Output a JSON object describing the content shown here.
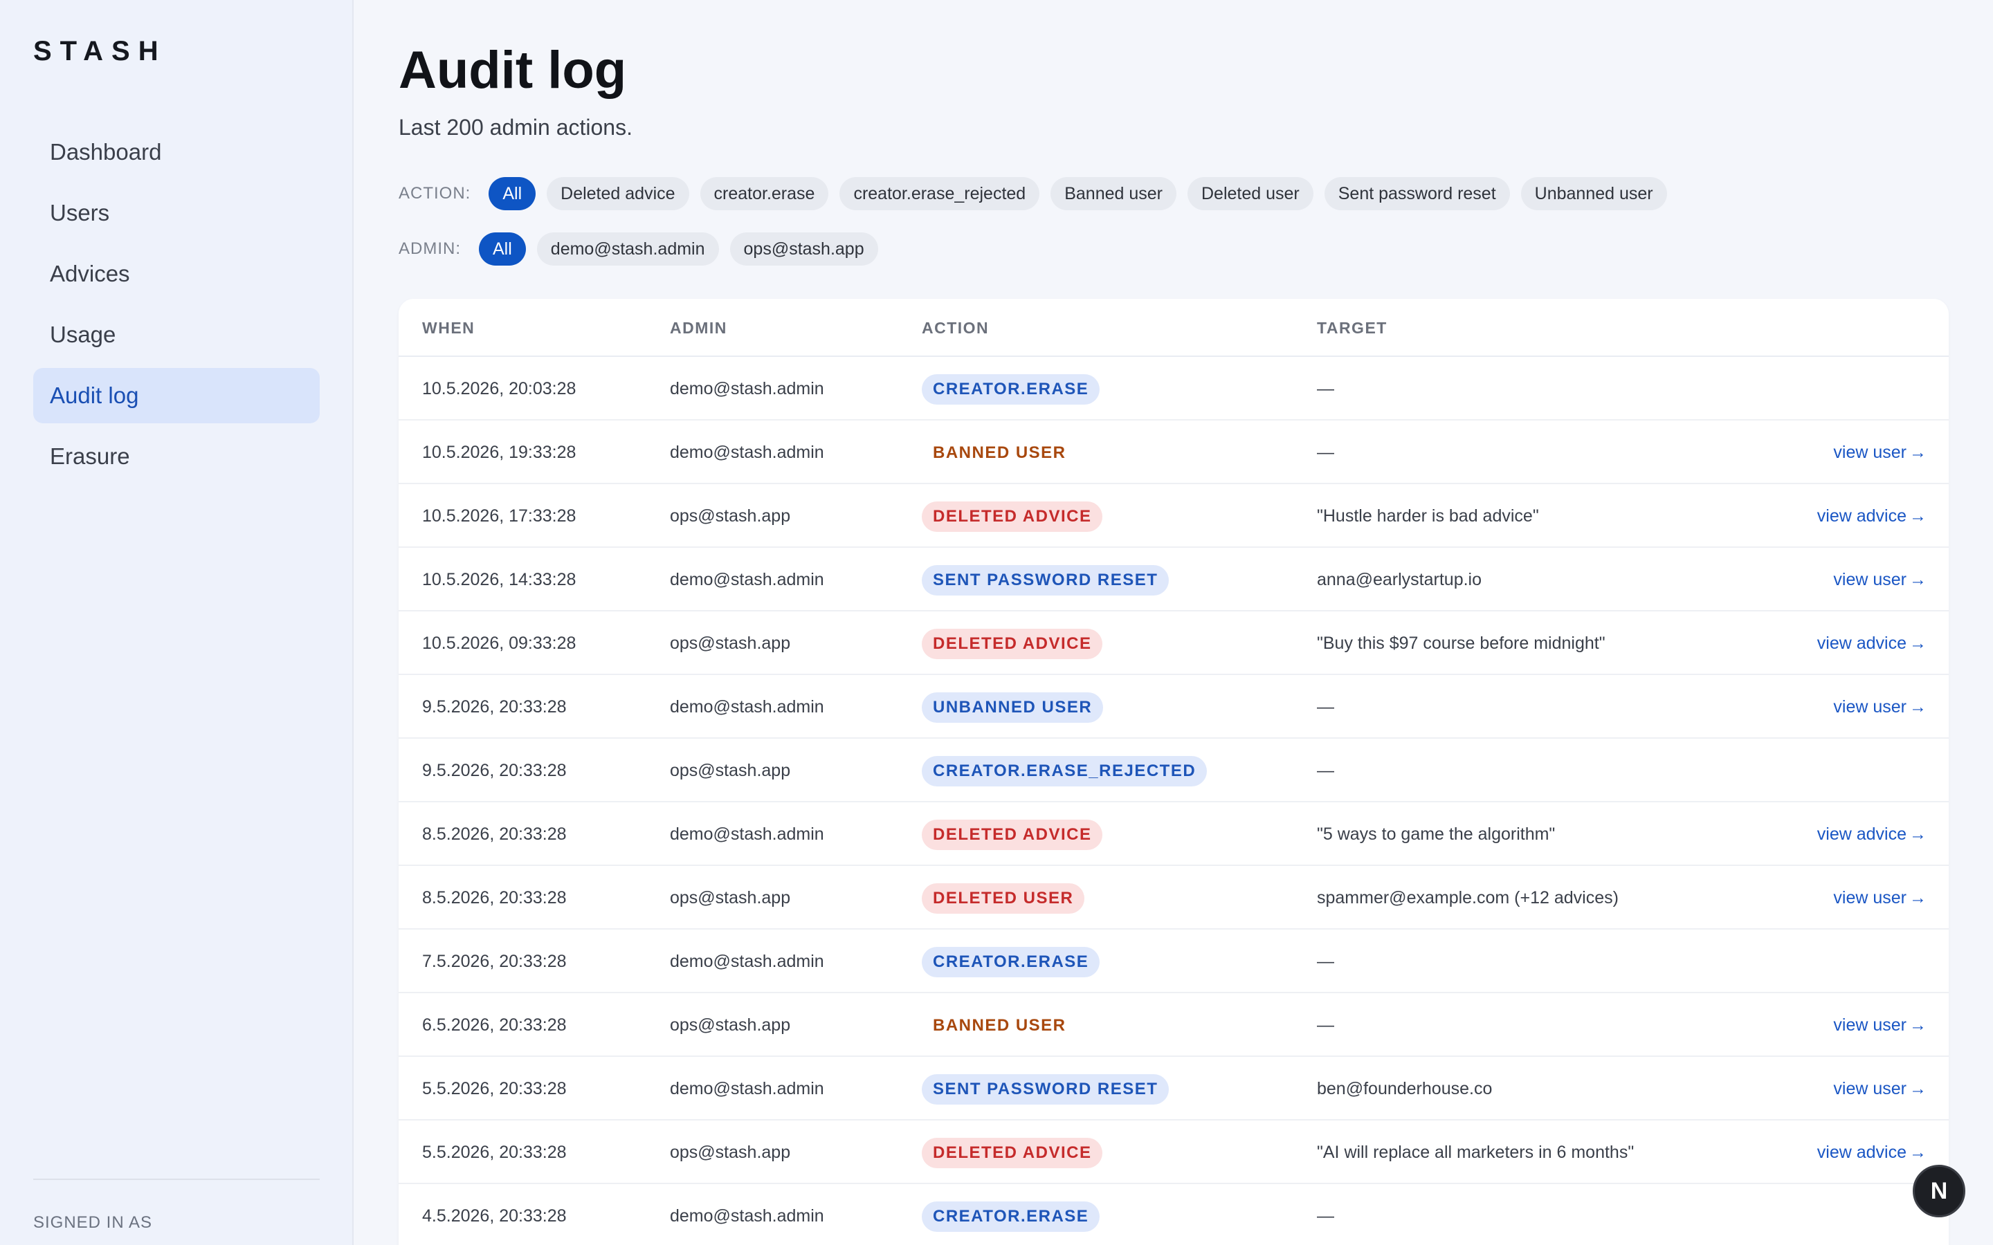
{
  "sidebar": {
    "logo": "STASH",
    "items": [
      {
        "label": "Dashboard",
        "active": false
      },
      {
        "label": "Users",
        "active": false
      },
      {
        "label": "Advices",
        "active": false
      },
      {
        "label": "Usage",
        "active": false
      },
      {
        "label": "Audit log",
        "active": true
      },
      {
        "label": "Erasure",
        "active": false
      }
    ],
    "signed_in_label": "SIGNED IN AS"
  },
  "header": {
    "title": "Audit log",
    "subtitle": "Last 200 admin actions."
  },
  "filters": {
    "action": {
      "label": "ACTION:",
      "chips": [
        "All",
        "Deleted advice",
        "creator.erase",
        "creator.erase_rejected",
        "Banned user",
        "Deleted user",
        "Sent password reset",
        "Unbanned user"
      ],
      "selected": "All"
    },
    "admin": {
      "label": "ADMIN:",
      "chips": [
        "All",
        "demo@stash.admin",
        "ops@stash.app"
      ],
      "selected": "All"
    }
  },
  "table": {
    "columns": [
      "WHEN",
      "ADMIN",
      "ACTION",
      "TARGET"
    ],
    "rows": [
      {
        "when": "10.5.2026, 20:03:28",
        "admin": "demo@stash.admin",
        "action": "CREATOR.ERASE",
        "tone": "blue",
        "target": "—",
        "link": ""
      },
      {
        "when": "10.5.2026, 19:33:28",
        "admin": "demo@stash.admin",
        "action": "BANNED USER",
        "tone": "orange",
        "target": "—",
        "link": "view user"
      },
      {
        "when": "10.5.2026, 17:33:28",
        "admin": "ops@stash.app",
        "action": "DELETED ADVICE",
        "tone": "red",
        "target": "\"Hustle harder is bad advice\"",
        "link": "view advice"
      },
      {
        "when": "10.5.2026, 14:33:28",
        "admin": "demo@stash.admin",
        "action": "SENT PASSWORD RESET",
        "tone": "blue",
        "target": "anna@earlystartup.io",
        "link": "view user"
      },
      {
        "when": "10.5.2026, 09:33:28",
        "admin": "ops@stash.app",
        "action": "DELETED ADVICE",
        "tone": "red",
        "target": "\"Buy this $97 course before midnight\"",
        "link": "view advice"
      },
      {
        "when": "9.5.2026, 20:33:28",
        "admin": "demo@stash.admin",
        "action": "UNBANNED USER",
        "tone": "blue",
        "target": "—",
        "link": "view user"
      },
      {
        "when": "9.5.2026, 20:33:28",
        "admin": "ops@stash.app",
        "action": "CREATOR.ERASE_REJECTED",
        "tone": "blue",
        "target": "—",
        "link": ""
      },
      {
        "when": "8.5.2026, 20:33:28",
        "admin": "demo@stash.admin",
        "action": "DELETED ADVICE",
        "tone": "red",
        "target": "\"5 ways to game the algorithm\"",
        "link": "view advice"
      },
      {
        "when": "8.5.2026, 20:33:28",
        "admin": "ops@stash.app",
        "action": "DELETED USER",
        "tone": "red",
        "target": "spammer@example.com (+12 advices)",
        "link": "view user"
      },
      {
        "when": "7.5.2026, 20:33:28",
        "admin": "demo@stash.admin",
        "action": "CREATOR.ERASE",
        "tone": "blue",
        "target": "—",
        "link": ""
      },
      {
        "when": "6.5.2026, 20:33:28",
        "admin": "ops@stash.app",
        "action": "BANNED USER",
        "tone": "orange",
        "target": "—",
        "link": "view user"
      },
      {
        "when": "5.5.2026, 20:33:28",
        "admin": "demo@stash.admin",
        "action": "SENT PASSWORD RESET",
        "tone": "blue",
        "target": "ben@founderhouse.co",
        "link": "view user"
      },
      {
        "when": "5.5.2026, 20:33:28",
        "admin": "ops@stash.app",
        "action": "DELETED ADVICE",
        "tone": "red",
        "target": "\"AI will replace all marketers in 6 months\"",
        "link": "view advice"
      },
      {
        "when": "4.5.2026, 20:33:28",
        "admin": "demo@stash.admin",
        "action": "CREATOR.ERASE",
        "tone": "blue",
        "target": "—",
        "link": ""
      }
    ]
  },
  "fab": {
    "label": "N"
  }
}
